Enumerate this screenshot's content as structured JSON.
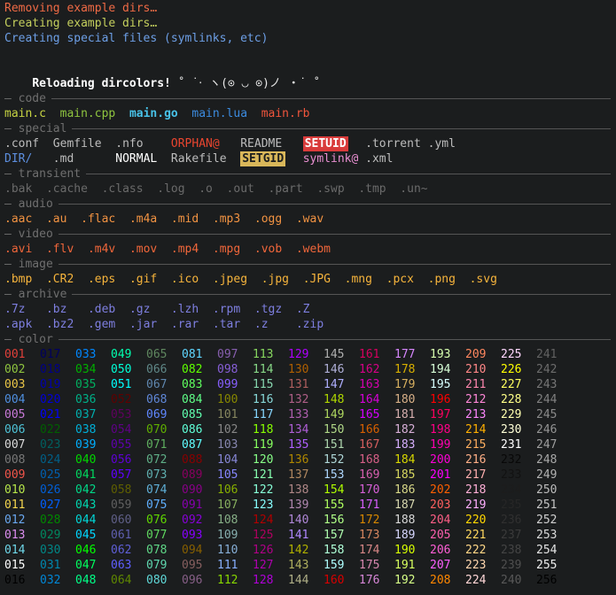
{
  "colors": {
    "background": "#1b1d1e",
    "msg_red": "#f2663b",
    "msg_yellow": "#c5d659",
    "msg_blue": "#66a2e8"
  },
  "messages": [
    {
      "text": "Removing example dirs…",
      "color": "#ef6a45"
    },
    {
      "text": "Creating example dirs…",
      "color": "#c4cf5d"
    },
    {
      "text": "Creating special files (symlinks, etc)",
      "color": "#6d9fe6"
    }
  ],
  "reload_line": {
    "label": "Reloading dircolors!",
    "kaomoji": "˚ ˙‧ ヽ(⊙ ◡ ⊙)ノ ‧˙ ˚"
  },
  "sections": [
    {
      "title": "code",
      "rows": [
        [
          {
            "text": "main.c",
            "color": "#c7d442",
            "bold": false
          },
          {
            "text": "main.cpp",
            "color": "#8fc53f",
            "bold": false
          },
          {
            "text": "main.go",
            "color": "#48c2e8",
            "bold": true
          },
          {
            "text": "main.lua",
            "color": "#3c8ce0",
            "bold": false
          },
          {
            "text": "main.rb",
            "color": "#f0553c",
            "bold": false
          }
        ]
      ]
    },
    {
      "title": "special",
      "rows": [
        [
          {
            "text": ".conf",
            "color": "#bdbdbd"
          },
          {
            "text": "Gemfile",
            "color": "#bdbdbd"
          },
          {
            "text": ".nfo",
            "color": "#bdbdbd"
          },
          {
            "text": "ORPHAN@",
            "color": "#e8452f",
            "suffix": "",
            "special": "orphan"
          },
          {
            "text": "README",
            "color": "#bdbdbd"
          },
          {
            "text": "SETUID",
            "color": "#ffffff",
            "bg": "#d93b3b",
            "bold": true
          },
          {
            "text": ".torrent",
            "color": "#bdbdbd"
          },
          {
            "text": ".yml",
            "color": "#bdbdbd"
          }
        ],
        [
          {
            "text": "DIR/",
            "color": "#5d8fdf",
            "special": "dir"
          },
          {
            "text": ".md",
            "color": "#bdbdbd"
          },
          {
            "text": "NORMAL",
            "color": "#ffffff",
            "bold": false
          },
          {
            "text": "Rakefile",
            "color": "#bdbdbd"
          },
          {
            "text": "SETGID",
            "color": "#1b1d1e",
            "bg": "#d9b75a",
            "bold": true
          },
          {
            "text": "symlink@",
            "color": "#e98fd1",
            "special": "symlink"
          },
          {
            "text": ".xml",
            "color": "#bdbdbd"
          }
        ]
      ]
    },
    {
      "title": "transient",
      "rows": [
        [
          {
            "text": ".bak",
            "color": "#6a6a6a"
          },
          {
            "text": ".cache",
            "color": "#6a6a6a"
          },
          {
            "text": ".class",
            "color": "#6a6a6a"
          },
          {
            "text": ".log",
            "color": "#6a6a6a"
          },
          {
            "text": ".o",
            "color": "#6a6a6a"
          },
          {
            "text": ".out",
            "color": "#6a6a6a"
          },
          {
            "text": ".part",
            "color": "#6a6a6a"
          },
          {
            "text": ".swp",
            "color": "#6a6a6a"
          },
          {
            "text": ".tmp",
            "color": "#6a6a6a"
          },
          {
            "text": ".un~",
            "color": "#6a6a6a"
          }
        ]
      ]
    },
    {
      "title": "audio",
      "rows": [
        [
          {
            "text": ".aac",
            "color": "#f29342"
          },
          {
            "text": ".au",
            "color": "#f29342"
          },
          {
            "text": ".flac",
            "color": "#f29342"
          },
          {
            "text": ".m4a",
            "color": "#f29342"
          },
          {
            "text": ".mid",
            "color": "#f29342"
          },
          {
            "text": ".mp3",
            "color": "#f29342"
          },
          {
            "text": ".ogg",
            "color": "#f29342"
          },
          {
            "text": ".wav",
            "color": "#f29342"
          }
        ]
      ]
    },
    {
      "title": "video",
      "rows": [
        [
          {
            "text": ".avi",
            "color": "#f0663a"
          },
          {
            "text": ".flv",
            "color": "#f0663a"
          },
          {
            "text": ".m4v",
            "color": "#f0663a"
          },
          {
            "text": ".mov",
            "color": "#f0663a"
          },
          {
            "text": ".mp4",
            "color": "#f0663a"
          },
          {
            "text": ".mpg",
            "color": "#f0663a"
          },
          {
            "text": ".vob",
            "color": "#f0663a"
          },
          {
            "text": ".webm",
            "color": "#f0663a"
          }
        ]
      ]
    },
    {
      "title": "image",
      "rows": [
        [
          {
            "text": ".bmp",
            "color": "#f6b43c"
          },
          {
            "text": ".CR2",
            "color": "#f6b43c"
          },
          {
            "text": ".eps",
            "color": "#f6b43c"
          },
          {
            "text": ".gif",
            "color": "#f6b43c"
          },
          {
            "text": ".ico",
            "color": "#f6b43c"
          },
          {
            "text": ".jpeg",
            "color": "#f6b43c"
          },
          {
            "text": ".jpg",
            "color": "#f6b43c"
          },
          {
            "text": ".JPG",
            "color": "#f6b43c"
          },
          {
            "text": ".mng",
            "color": "#f6b43c"
          },
          {
            "text": ".pcx",
            "color": "#f6b43c"
          },
          {
            "text": ".png",
            "color": "#f6b43c"
          },
          {
            "text": ".svg",
            "color": "#f6b43c"
          }
        ]
      ]
    },
    {
      "title": "archive",
      "rows": [
        [
          {
            "text": ".7z",
            "color": "#7e7fe0"
          },
          {
            "text": ".bz",
            "color": "#7e7fe0"
          },
          {
            "text": ".deb",
            "color": "#7e7fe0"
          },
          {
            "text": ".gz",
            "color": "#7e7fe0"
          },
          {
            "text": ".lzh",
            "color": "#7e7fe0"
          },
          {
            "text": ".rpm",
            "color": "#7e7fe0"
          },
          {
            "text": ".tgz",
            "color": "#7e7fe0"
          },
          {
            "text": ".Z",
            "color": "#7e7fe0"
          }
        ],
        [
          {
            "text": ".apk",
            "color": "#7e7fe0"
          },
          {
            "text": ".bz2",
            "color": "#7e7fe0"
          },
          {
            "text": ".gem",
            "color": "#7e7fe0"
          },
          {
            "text": ".jar",
            "color": "#7e7fe0"
          },
          {
            "text": ".rar",
            "color": "#7e7fe0"
          },
          {
            "text": ".tar",
            "color": "#7e7fe0"
          },
          {
            "text": ".z",
            "color": "#7e7fe0"
          },
          {
            "text": ".zip",
            "color": "#7e7fe0"
          }
        ]
      ]
    },
    {
      "title": "color",
      "rows": []
    }
  ],
  "color_grid": {
    "columns": [
      [
        "001",
        "002",
        "003",
        "004",
        "005",
        "006",
        "007",
        "008",
        "009",
        "010",
        "011",
        "012",
        "013",
        "014",
        "015",
        "016"
      ],
      [
        "017",
        "018",
        "019",
        "020",
        "021",
        "022",
        "023",
        "024",
        "025",
        "026",
        "027",
        "028",
        "029",
        "030",
        "031",
        "032"
      ],
      [
        "033",
        "034",
        "035",
        "036",
        "037",
        "038",
        "039",
        "040",
        "041",
        "042",
        "043",
        "044",
        "045",
        "046",
        "047",
        "048"
      ],
      [
        "049",
        "050",
        "051",
        "052",
        "053",
        "054",
        "055",
        "056",
        "057",
        "058",
        "059",
        "060",
        "061",
        "062",
        "063",
        "064"
      ],
      [
        "065",
        "066",
        "067",
        "068",
        "069",
        "070",
        "071",
        "072",
        "073",
        "074",
        "075",
        "076",
        "077",
        "078",
        "079",
        "080"
      ],
      [
        "081",
        "082",
        "083",
        "084",
        "085",
        "086",
        "087",
        "088",
        "089",
        "090",
        "091",
        "092",
        "093",
        "094",
        "095",
        "096"
      ],
      [
        "097",
        "098",
        "099",
        "100",
        "101",
        "102",
        "103",
        "104",
        "105",
        "106",
        "107",
        "108",
        "109",
        "110",
        "111",
        "112"
      ],
      [
        "113",
        "114",
        "115",
        "116",
        "117",
        "118",
        "119",
        "120",
        "121",
        "122",
        "123",
        "124",
        "125",
        "126",
        "127",
        "128"
      ],
      [
        "129",
        "130",
        "131",
        "132",
        "133",
        "134",
        "135",
        "136",
        "137",
        "138",
        "139",
        "140",
        "141",
        "142",
        "143",
        "144"
      ],
      [
        "145",
        "146",
        "147",
        "148",
        "149",
        "150",
        "151",
        "152",
        "153",
        "154",
        "155",
        "156",
        "157",
        "158",
        "159",
        "160"
      ],
      [
        "161",
        "162",
        "163",
        "164",
        "165",
        "166",
        "167",
        "168",
        "169",
        "170",
        "171",
        "172",
        "173",
        "174",
        "175",
        "176"
      ],
      [
        "177",
        "178",
        "179",
        "180",
        "181",
        "182",
        "183",
        "184",
        "185",
        "186",
        "187",
        "188",
        "189",
        "190",
        "191",
        "192"
      ],
      [
        "193",
        "194",
        "195",
        "196",
        "197",
        "198",
        "199",
        "200",
        "201",
        "202",
        "203",
        "204",
        "205",
        "206",
        "207",
        "208"
      ],
      [
        "209",
        "210",
        "211",
        "212",
        "213",
        "214",
        "215",
        "216",
        "217",
        "218",
        "219",
        "220",
        "221",
        "222",
        "223",
        "224"
      ],
      [
        "225",
        "226",
        "227",
        "228",
        "229",
        "230",
        "231",
        "232",
        "233",
        "234",
        "235",
        "236",
        "237",
        "238",
        "239",
        "240"
      ],
      [
        "241",
        "242",
        "243",
        "244",
        "245",
        "246",
        "247",
        "248",
        "249",
        "250",
        "251",
        "252",
        "253",
        "254",
        "255",
        "256"
      ]
    ],
    "palette_16": [
      "#000000",
      "#e0403a",
      "#8fc53f",
      "#e8c547",
      "#4f8fe0",
      "#c879d8",
      "#4ec2d6",
      "#d8d8d8",
      "#777777",
      "#f0554a",
      "#b6e64a",
      "#f5d64f",
      "#6aa8f0",
      "#dc8ef0",
      "#6fd8ea",
      "#ffffff"
    ]
  }
}
